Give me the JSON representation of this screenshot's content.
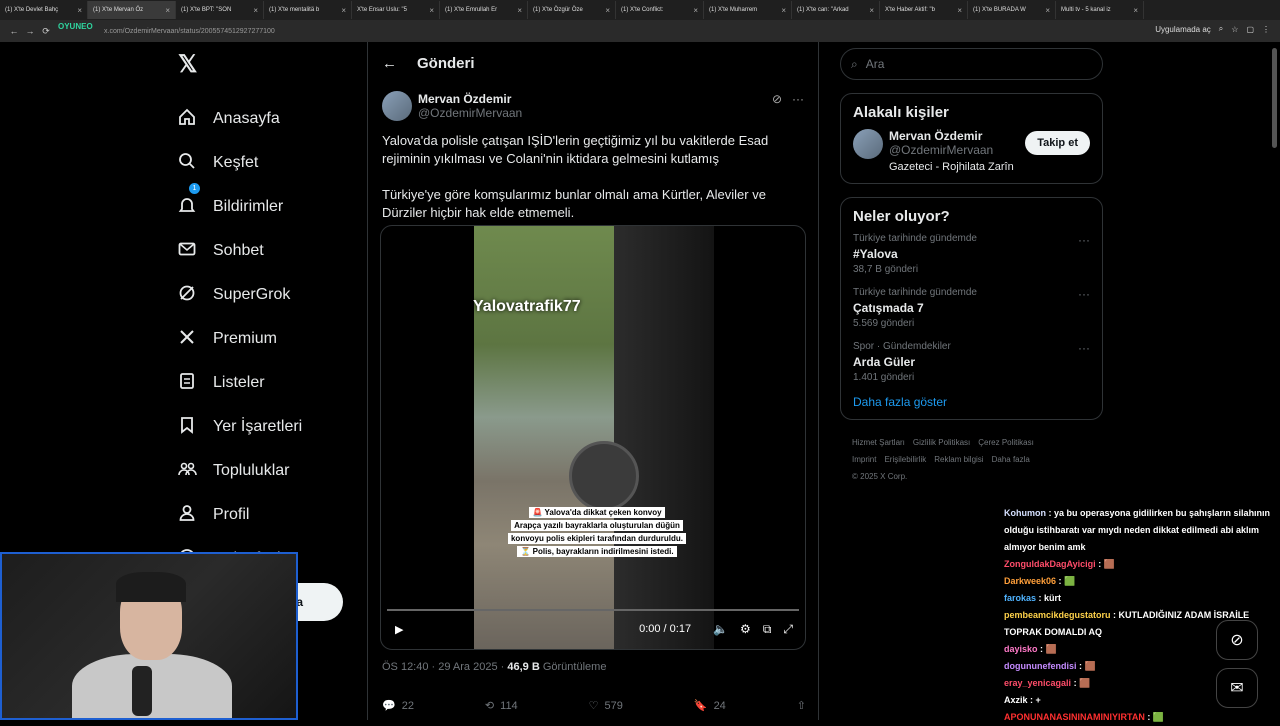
{
  "browser": {
    "tabs": [
      {
        "label": "(1) X'te Devlet Bahç",
        "active": false
      },
      {
        "label": "(1) X'te Mervan Öz",
        "active": true
      },
      {
        "label": "(1) X'te BPT: \"SON",
        "active": false
      },
      {
        "label": "(1) X'te mentalitä b",
        "active": false
      },
      {
        "label": "X'te Ensar Uslu: \"5",
        "active": false
      },
      {
        "label": "(1) X'te Emrullah Er",
        "active": false
      },
      {
        "label": "(1) X'te Özgür Öze",
        "active": false
      },
      {
        "label": "(1) X'te Conflict:",
        "active": false
      },
      {
        "label": "(1) X'te Muharrem",
        "active": false
      },
      {
        "label": "(1) X'te can: \"Arkad",
        "active": false
      },
      {
        "label": "X'te Haber Aktif: \"b",
        "active": false
      },
      {
        "label": "(1) X'te BURADA W",
        "active": false
      },
      {
        "label": "Multi tv - 5 kanal iz",
        "active": false
      }
    ],
    "url": "x.com/OzdemirMervaan/status/2005574512927277100",
    "app_button": "Uygulamada aç",
    "overlay_logo": "OYUNEO"
  },
  "nav": {
    "items": [
      {
        "label": "Anasayfa",
        "icon": "home-icon"
      },
      {
        "label": "Keşfet",
        "icon": "search-icon"
      },
      {
        "label": "Bildirimler",
        "icon": "bell-icon",
        "badge": "1"
      },
      {
        "label": "Sohbet",
        "icon": "mail-icon"
      },
      {
        "label": "SuperGrok",
        "icon": "grok-icon"
      },
      {
        "label": "Premium",
        "icon": "x-icon"
      },
      {
        "label": "Listeler",
        "icon": "list-icon"
      },
      {
        "label": "Yer İşaretleri",
        "icon": "bookmark-icon"
      },
      {
        "label": "Topluluklar",
        "icon": "communities-icon"
      },
      {
        "label": "Profil",
        "icon": "profile-icon"
      },
      {
        "label": "Daha fazla",
        "icon": "more-icon"
      }
    ],
    "post_button": "a"
  },
  "header": {
    "title": "Gönderi"
  },
  "tweet": {
    "author_name": "Mervan Özdemir",
    "author_handle": "@OzdemirMervaan",
    "text_1": "Yalova'da polisle çatışan IŞİD'lerin geçtiğimiz yıl bu vakitlerde Esad rejiminin yıkılması ve Colani'nin iktidara gelmesini kutlamış",
    "text_2": "Türkiye'ye göre komşularımız bunlar olmalı ama Kürtler, Aleviler ve Dürziler hiçbir hak elde etmemeli.",
    "video_watermark": "Yalovatrafik77",
    "video_caption_1": "🚨 Yalova'da dikkat çeken konvoy",
    "video_caption_2": "Arapça yazılı bayraklarla oluşturulan düğün",
    "video_caption_3": "konvoyu polis ekipleri tarafından durduruldu.",
    "video_caption_4": "⏳ Polis, bayrakların indirilmesini istedi.",
    "video_time": "0:00 / 0:17",
    "video_progress": 0,
    "timestamp": "ÖS 12:40 · 29 Ara 2025 · ",
    "views": "46,9 B",
    "views_label": "Görüntüleme",
    "replies": "22",
    "reposts": "114",
    "likes": "579",
    "bookmarks": "24"
  },
  "sidebar": {
    "search_placeholder": "Ara",
    "related_title": "Alakalı kişiler",
    "person_name": "Mervan Özdemir",
    "person_handle": "@OzdemirMervaan",
    "person_bio": "Gazeteci - Rojhilata Zarîn",
    "follow_label": "Takip et",
    "trends_title": "Neler oluyor?",
    "trends": [
      {
        "context": "Türkiye tarihinde gündemde",
        "name": "#Yalova",
        "count": "38,7 B gönderi"
      },
      {
        "context": "Türkiye tarihinde gündemde",
        "name": "Çatışmada 7",
        "count": "5.569 gönderi"
      },
      {
        "context": "Spor · Gündemdekiler",
        "name": "Arda Güler",
        "count": "1.401 gönderi"
      }
    ],
    "show_more": "Daha fazla göster",
    "footer": [
      "Hizmet Şartları",
      "Gizlilik Politikası",
      "Çerez Politikası",
      "Imprint",
      "Erişilebilirlik",
      "Reklam bilgisi",
      "Daha fazla"
    ],
    "copyright": "© 2025 X Corp."
  },
  "chat": [
    {
      "user": "Kohumon",
      "color": "#d5e0ff",
      "msg": "ya bu operasyona gidilirken bu şahışların silahının olduğu istihbaratı var mıydı neden dikkat edilmedi abi aklım almıyor benim amk"
    },
    {
      "user": "ZonguldakDagAyicigi",
      "color": "#ff4d6a",
      "msg": "🟫"
    },
    {
      "user": "Darkweek06",
      "color": "#ff9f3a",
      "msg": "🟩"
    },
    {
      "user": "farokas",
      "color": "#4fb3ff",
      "msg": "kürt"
    },
    {
      "user": "pembeamcikdegustatoru",
      "color": "#ffd24a",
      "msg": "KUTLADIĞINIZ ADAM İSRAİLE TOPRAK DOMALDI AQ"
    },
    {
      "user": "dayisko",
      "color": "#ff7ac8",
      "msg": "🟫"
    },
    {
      "user": "dogununefendisi",
      "color": "#c58bff",
      "msg": "🟫"
    },
    {
      "user": "eray_yenicagali",
      "color": "#ff4d6a",
      "msg": "🟫"
    },
    {
      "user": "Axzik",
      "color": "#ffffff",
      "msg": "+"
    },
    {
      "user": "APONUNANASININAMINIYIRTAN",
      "color": "#ff3030",
      "msg": "🟩"
    }
  ]
}
